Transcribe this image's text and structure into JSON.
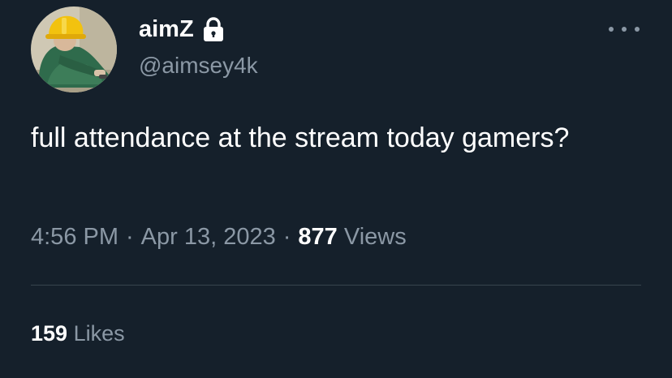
{
  "colors": {
    "background": "#15202b",
    "primary_text": "#ffffff",
    "secondary_text": "#8b98a5",
    "divider": "#38444d"
  },
  "user": {
    "display_name": "aimZ",
    "handle": "@aimsey4k",
    "verified_icon": "lock-icon",
    "avatar_icon": "avatar-person-in-yellow-hardhat"
  },
  "tweet": {
    "text": "full attendance at the stream today gamers?",
    "time": "4:56 PM",
    "separator": "·",
    "date": "Apr 13, 2023",
    "views_count": "877",
    "views_label": "Views"
  },
  "stats": {
    "likes_count": "159",
    "likes_label": "Likes"
  },
  "menu": {
    "more_icon": "more-horizontal-icon"
  }
}
